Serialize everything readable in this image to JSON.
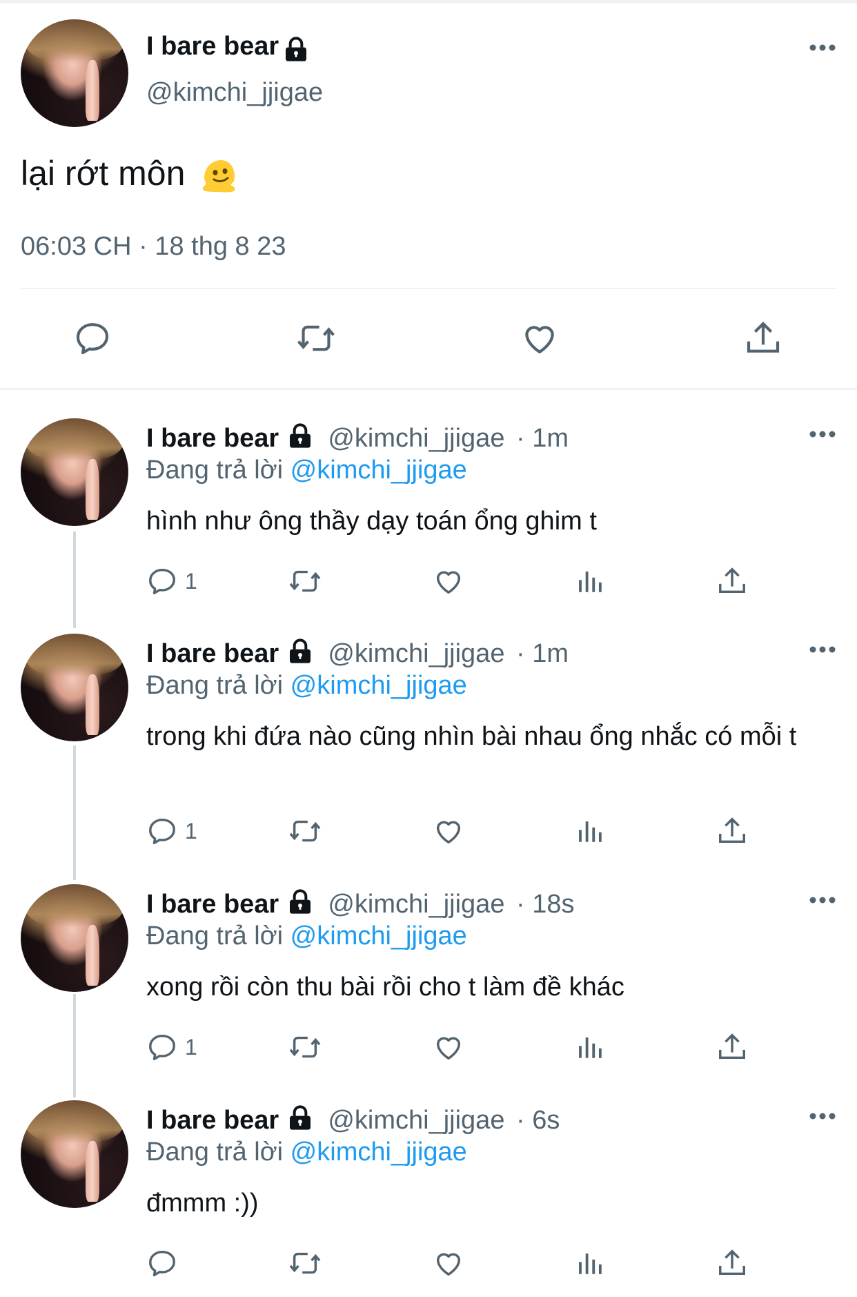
{
  "main_tweet": {
    "display_name": "I bare bear",
    "handle": "@kimchi_jjigae",
    "text": "lại rớt môn",
    "emoji": "melting-face-emoji",
    "timestamp": "06:03 CH · 18 thg 8 23",
    "icons": {
      "reply": "reply-icon",
      "retweet": "retweet-icon",
      "like": "heart-icon",
      "share": "share-icon",
      "more": "more-icon",
      "lock": "lock-icon"
    }
  },
  "replying_label": "Đang trả lời",
  "replies": [
    {
      "display_name": "I bare bear",
      "handle": "@kimchi_jjigae",
      "time": "· 1m",
      "replying_to": "@kimchi_jjigae",
      "text": "hình như ông thầy dạy toán ổng ghim t",
      "reply_count": "1"
    },
    {
      "display_name": "I bare bear",
      "handle": "@kimchi_jjigae",
      "time": "· 1m",
      "replying_to": "@kimchi_jjigae",
      "text": "trong khi đứa nào cũng nhìn bài nhau ổng nhắc có mỗi t",
      "reply_count": "1"
    },
    {
      "display_name": "I bare bear",
      "handle": "@kimchi_jjigae",
      "time": "· 18s",
      "replying_to": "@kimchi_jjigae",
      "text": "xong rồi còn thu bài rồi cho t làm đề khác",
      "reply_count": "1"
    },
    {
      "display_name": "I bare bear",
      "handle": "@kimchi_jjigae",
      "time": "· 6s",
      "replying_to": "@kimchi_jjigae",
      "text": "đmmm :))",
      "reply_count": ""
    }
  ],
  "colors": {
    "text": "#0f1419",
    "secondary": "#536471",
    "mention": "#1d9bf0",
    "divider": "#eff3f4",
    "thread_line": "#cfd9de"
  }
}
